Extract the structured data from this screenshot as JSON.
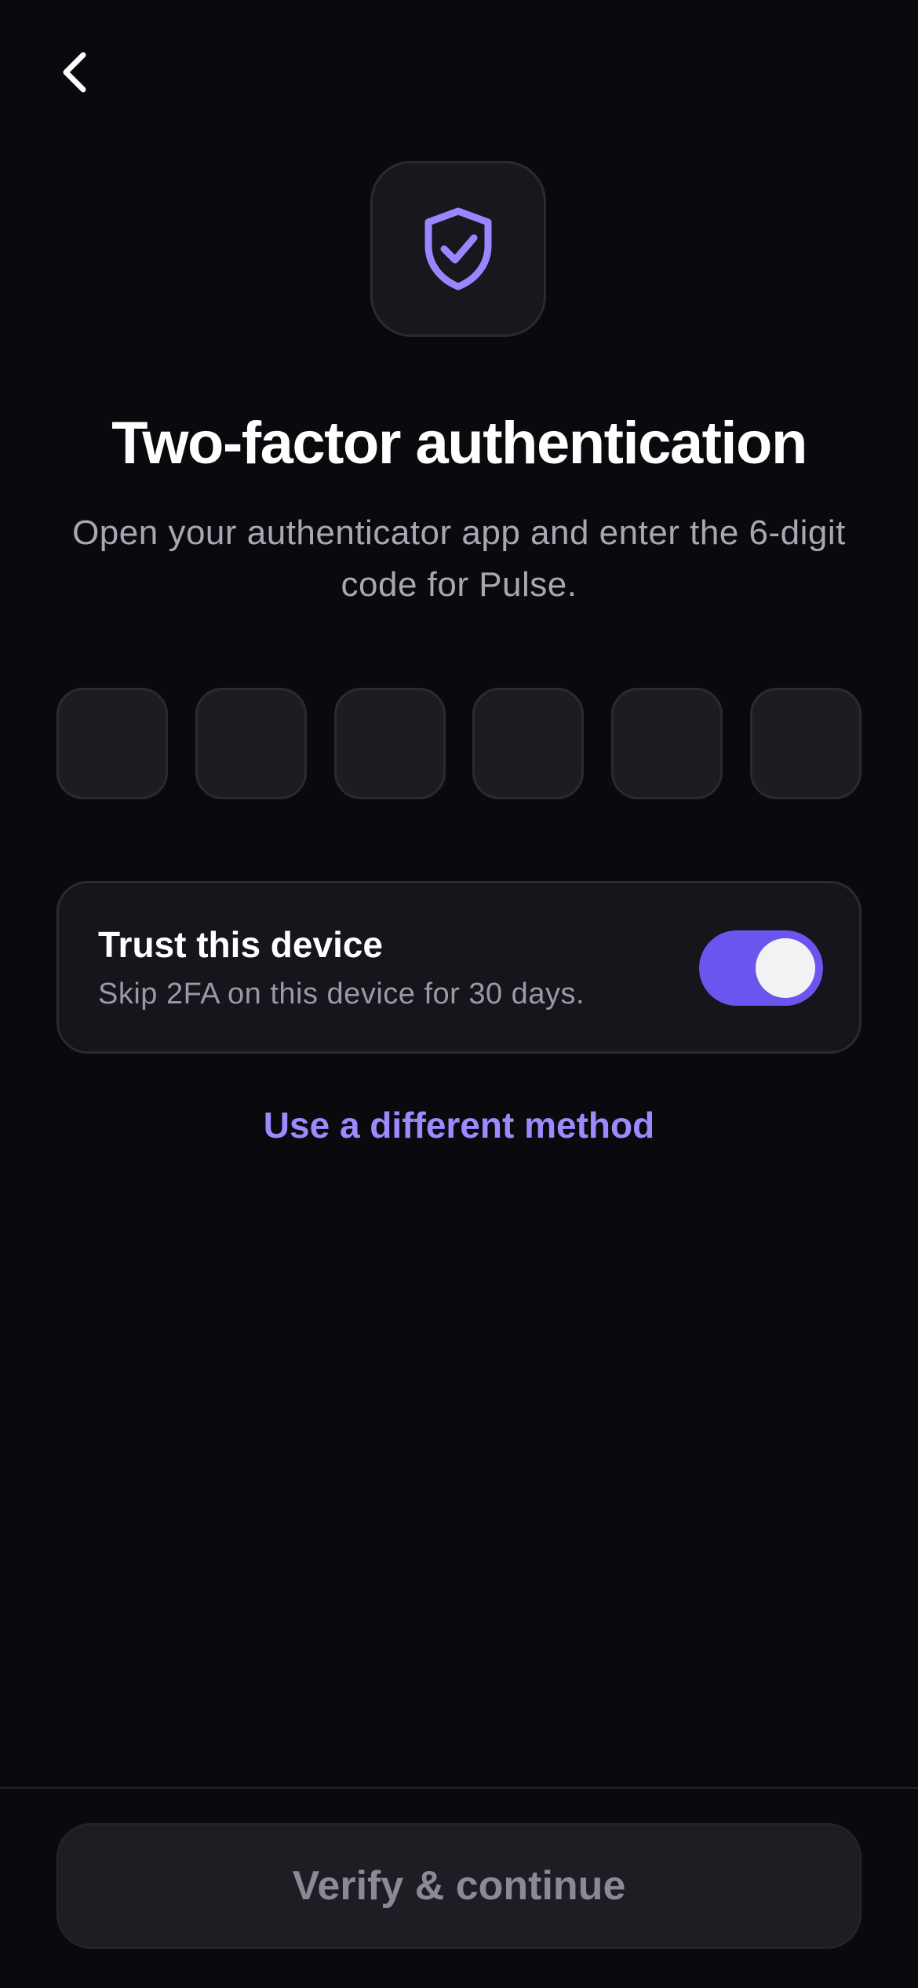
{
  "header": {
    "back_icon": "chevron-left-icon"
  },
  "hero": {
    "icon": "shield-check-icon",
    "icon_color": "#9a86ff"
  },
  "title": "Two-factor authentication",
  "subtitle": "Open your authenticator app and enter the 6-digit code for Pulse.",
  "code_inputs": [
    "",
    "",
    "",
    "",
    "",
    ""
  ],
  "trust_device": {
    "title": "Trust this device",
    "description": "Skip 2FA on this device for 30 days.",
    "enabled": true
  },
  "alt_method_label": "Use a different method",
  "verify_button_label": "Verify & continue",
  "colors": {
    "background": "#0a0a0e",
    "accent": "#6a55ee",
    "link": "#9d8aff",
    "card": "#15151b",
    "muted_text": "#a8a8b3"
  }
}
